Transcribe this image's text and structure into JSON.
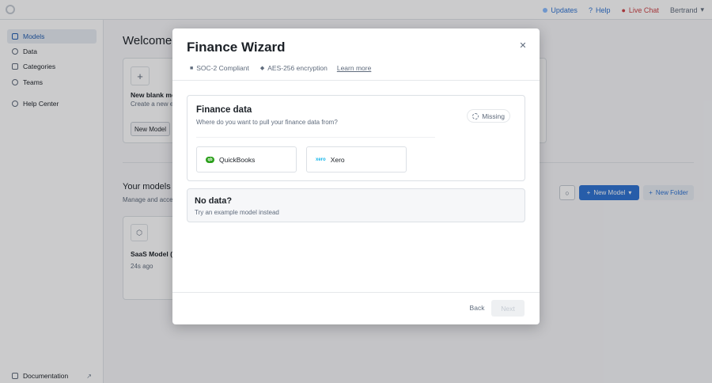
{
  "topnav": {
    "updates": "Updates",
    "help": "Help",
    "live_chat": "Live Chat",
    "user": "Bertrand"
  },
  "sidebar": {
    "items": [
      {
        "label": "Models",
        "icon": "models-icon",
        "active": true
      },
      {
        "label": "Data",
        "icon": "database-icon",
        "active": false
      },
      {
        "label": "Categories",
        "icon": "categories-icon",
        "active": false
      },
      {
        "label": "Teams",
        "icon": "people-icon",
        "active": false
      },
      {
        "label": "Help Center",
        "icon": "help-icon",
        "active": false
      }
    ],
    "documentation": "Documentation"
  },
  "main": {
    "welcome": "Welcome to",
    "blank_title": "New blank mo",
    "blank_sub": "Create a new e",
    "blank_button": "New Model",
    "your_models": "Your models",
    "your_sub": "Manage and acce",
    "new_model_button": "New Model",
    "new_folder_button": "New Folder",
    "model_card": {
      "title": "SaaS Model (C",
      "time": "24s ago"
    }
  },
  "dialog": {
    "title": "Finance Wizard",
    "badges": [
      "SOC-2 Compliant",
      "AES-256 encryption"
    ],
    "learn_more": "Learn more",
    "finance": {
      "title": "Finance data",
      "subtitle": "Where do you want to pull your finance data from?",
      "status": "Missing",
      "providers": [
        "QuickBooks",
        "Xero"
      ]
    },
    "no_data": {
      "title": "No data?",
      "subtitle": "Try an example model instead"
    },
    "back": "Back",
    "next": "Next"
  },
  "colors": {
    "accent": "#2d72d2",
    "live_chat": "#cd4246",
    "quickbooks": "#2ca01c",
    "xero": "#13b5ea"
  }
}
